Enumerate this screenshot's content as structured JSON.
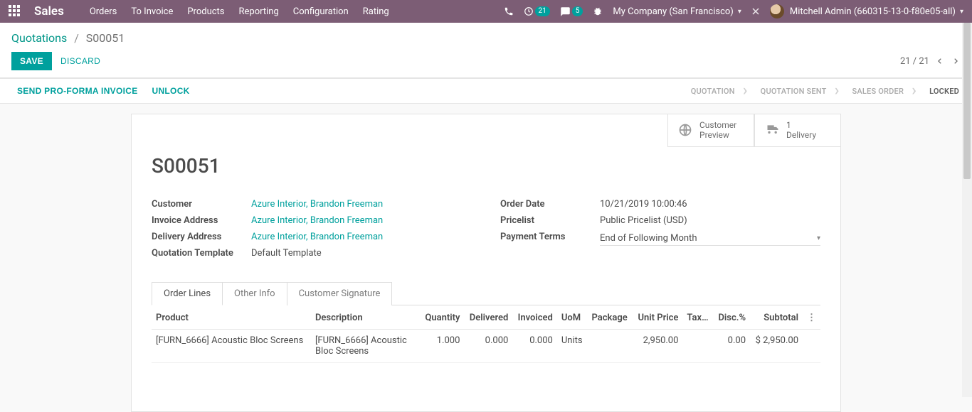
{
  "navbar": {
    "brand": "Sales",
    "menu": [
      "Orders",
      "To Invoice",
      "Products",
      "Reporting",
      "Configuration",
      "Rating"
    ],
    "clock_badge": "21",
    "chat_badge": "5",
    "company": "My Company (San Francisco)",
    "user": "Mitchell Admin (660315-13-0-f80e05-all)"
  },
  "breadcrumb": {
    "root": "Quotations",
    "current": "S00051"
  },
  "buttons": {
    "save": "SAVE",
    "discard": "DISCARD",
    "send_proforma": "SEND PRO-FORMA INVOICE",
    "unlock": "UNLOCK"
  },
  "pager": {
    "pos": "21 / 21"
  },
  "status_steps": [
    "QUOTATION",
    "QUOTATION SENT",
    "SALES ORDER",
    "LOCKED"
  ],
  "active_step_index": 3,
  "stat_buttons": {
    "preview": {
      "line1": "Customer",
      "line2": "Preview"
    },
    "delivery": {
      "line1": "1",
      "line2": "Delivery"
    }
  },
  "record": {
    "name": "S00051",
    "customer_label": "Customer",
    "customer": "Azure Interior, Brandon Freeman",
    "invoice_addr_label": "Invoice Address",
    "invoice_addr": "Azure Interior, Brandon Freeman",
    "delivery_addr_label": "Delivery Address",
    "delivery_addr": "Azure Interior, Brandon Freeman",
    "quote_tmpl_label": "Quotation Template",
    "quote_tmpl": "Default Template",
    "order_date_label": "Order Date",
    "order_date": "10/21/2019 10:00:46",
    "pricelist_label": "Pricelist",
    "pricelist": "Public Pricelist (USD)",
    "payment_terms_label": "Payment Terms",
    "payment_terms": "End of Following Month"
  },
  "tabs": [
    "Order Lines",
    "Other Info",
    "Customer Signature"
  ],
  "active_tab_index": 0,
  "table": {
    "headers": {
      "product": "Product",
      "description": "Description",
      "quantity": "Quantity",
      "delivered": "Delivered",
      "invoiced": "Invoiced",
      "uom": "UoM",
      "package": "Package",
      "unit_price": "Unit Price",
      "taxes": "Tax…",
      "disc": "Disc.%",
      "subtotal": "Subtotal"
    },
    "rows": [
      {
        "product": "[FURN_6666] Acoustic Bloc Screens",
        "description": "[FURN_6666] Acoustic Bloc Screens",
        "quantity": "1.000",
        "delivered": "0.000",
        "invoiced": "0.000",
        "uom": "Units",
        "package": "",
        "unit_price": "2,950.00",
        "taxes": "",
        "disc": "0.00",
        "subtotal": "$ 2,950.00"
      }
    ]
  }
}
